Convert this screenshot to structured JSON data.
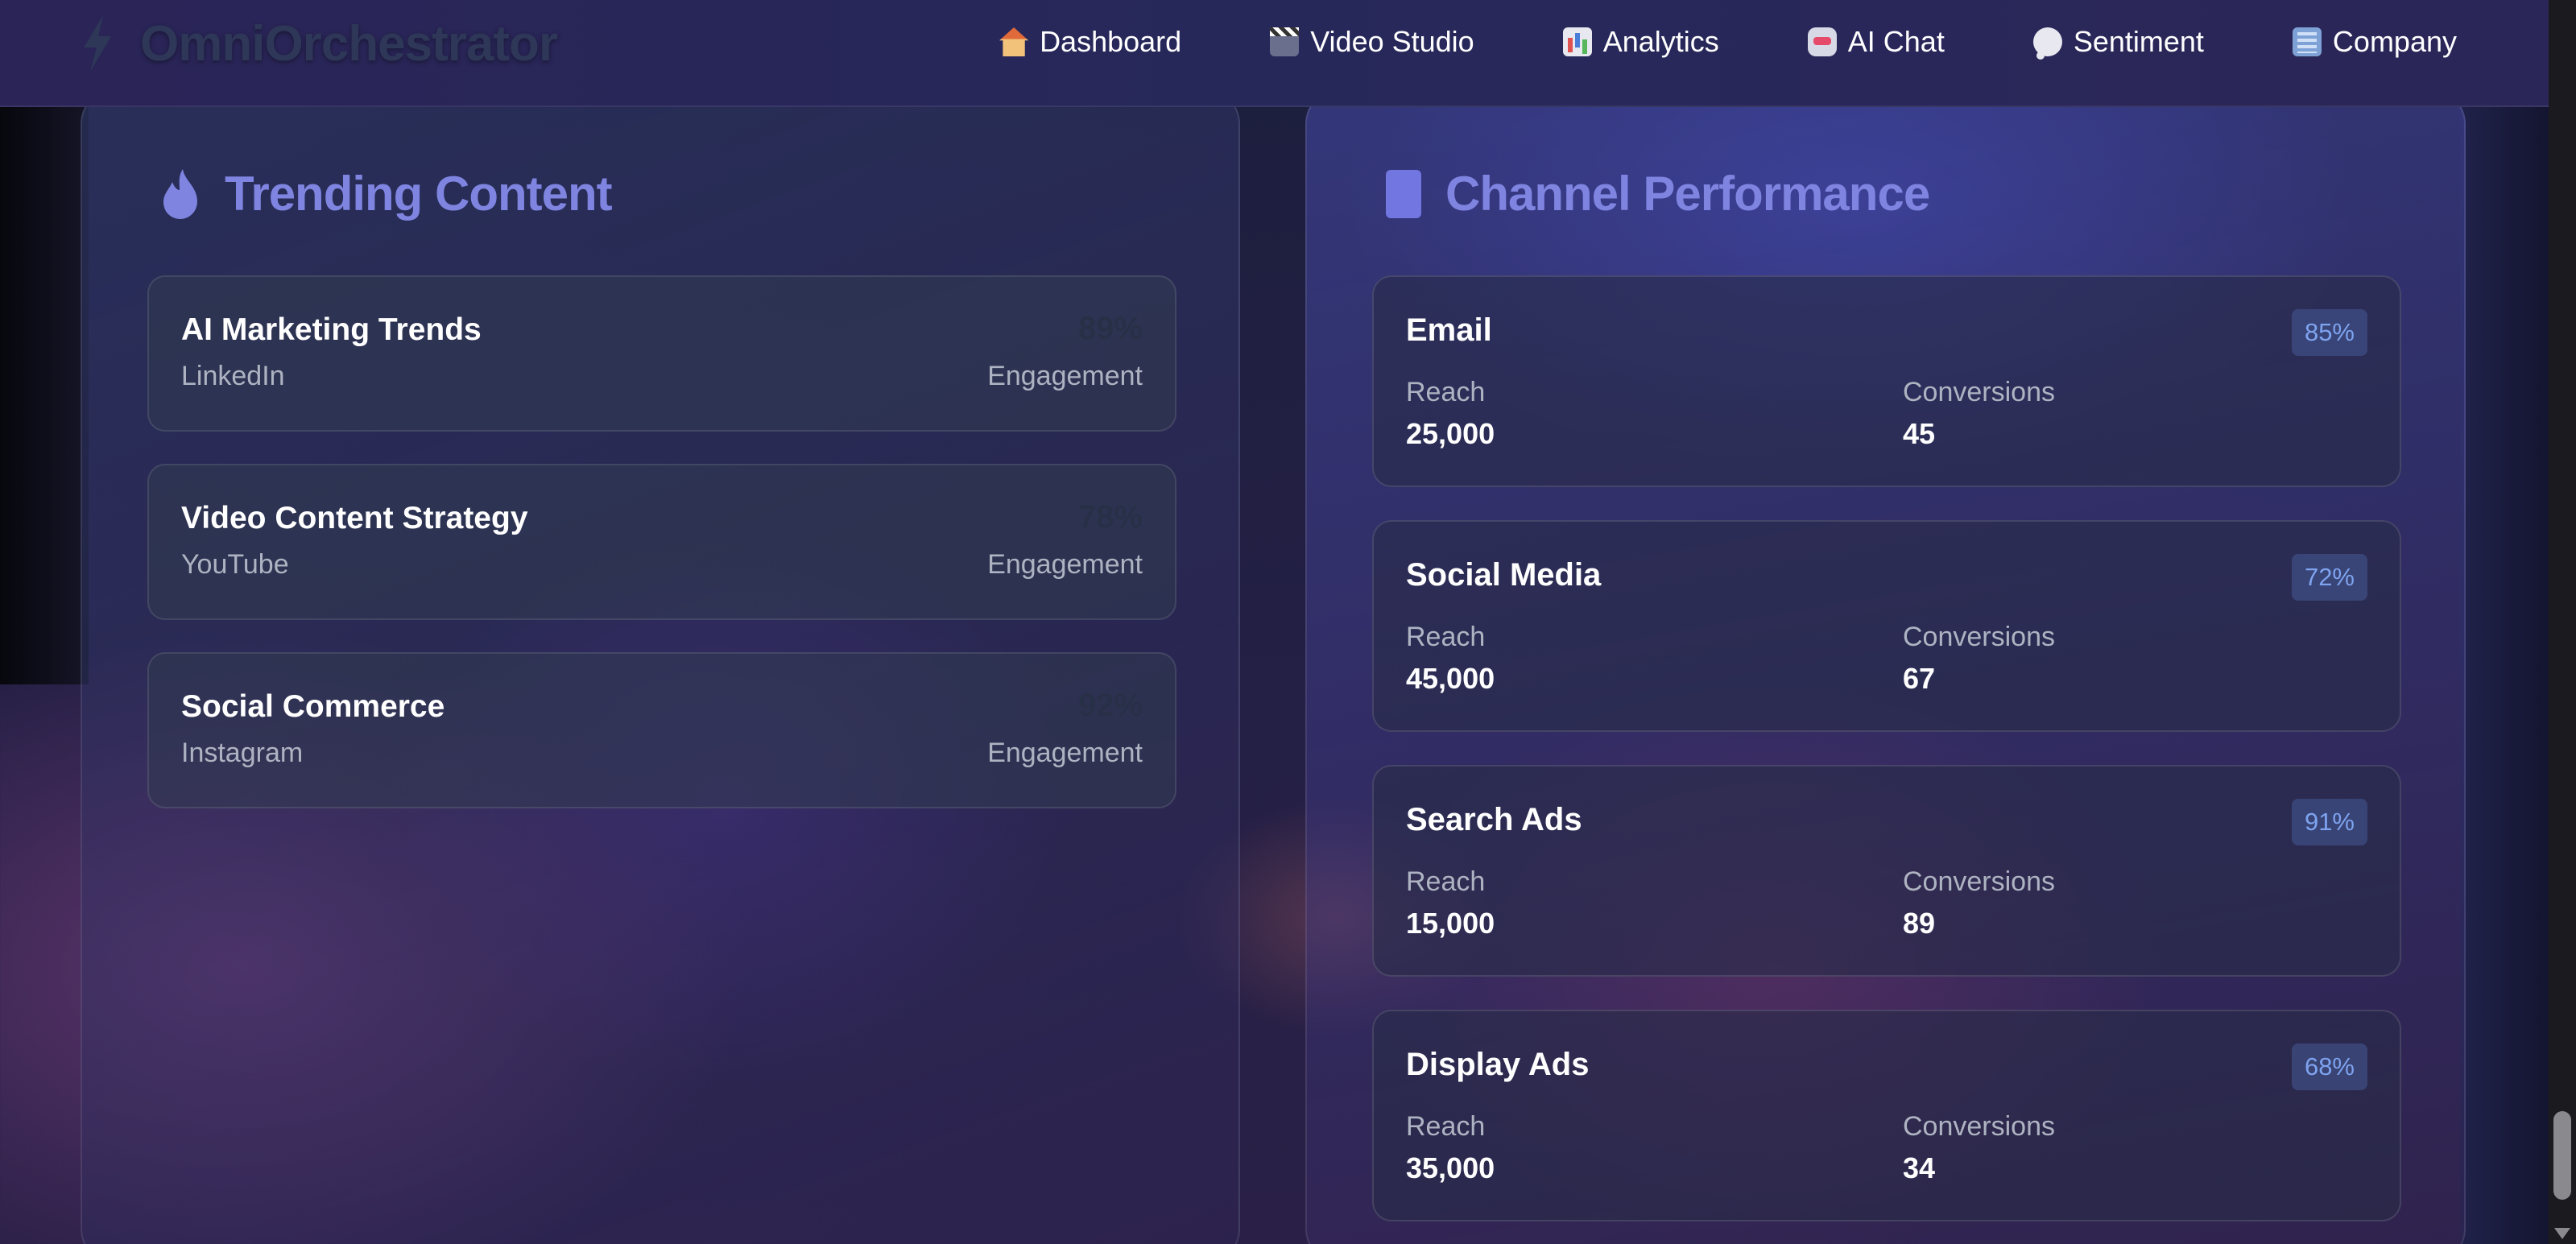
{
  "app": {
    "name": "OmniOrchestrator",
    "logo_icon": "lightning-icon"
  },
  "nav": {
    "items": [
      {
        "label": "Dashboard",
        "icon": "house-icon"
      },
      {
        "label": "Video Studio",
        "icon": "clapperboard-icon"
      },
      {
        "label": "Analytics",
        "icon": "bar-chart-icon"
      },
      {
        "label": "AI Chat",
        "icon": "robot-icon"
      },
      {
        "label": "Sentiment",
        "icon": "speech-bubble-icon"
      },
      {
        "label": "Company",
        "icon": "office-building-icon"
      }
    ]
  },
  "trending": {
    "title": "Trending Content",
    "icon": "flame-icon",
    "items": [
      {
        "title": "AI Marketing Trends",
        "platform": "LinkedIn",
        "metric_label": "Engagement",
        "engagement": "89%"
      },
      {
        "title": "Video Content Strategy",
        "platform": "YouTube",
        "metric_label": "Engagement",
        "engagement": "78%"
      },
      {
        "title": "Social Commerce",
        "platform": "Instagram",
        "metric_label": "Engagement",
        "engagement": "92%"
      }
    ]
  },
  "channels": {
    "title": "Channel Performance",
    "icon": "bar-icon",
    "reach_label": "Reach",
    "conversions_label": "Conversions",
    "items": [
      {
        "name": "Email",
        "badge": "85%",
        "reach": "25,000",
        "conversions": "45"
      },
      {
        "name": "Social Media",
        "badge": "72%",
        "reach": "45,000",
        "conversions": "67"
      },
      {
        "name": "Search Ads",
        "badge": "91%",
        "reach": "15,000",
        "conversions": "89"
      },
      {
        "name": "Display Ads",
        "badge": "68%",
        "reach": "35,000",
        "conversions": "34"
      }
    ]
  },
  "colors": {
    "accent": "#7e84e0",
    "badge_text": "#7ea3ef",
    "muted_text": "#aeb3c2"
  }
}
